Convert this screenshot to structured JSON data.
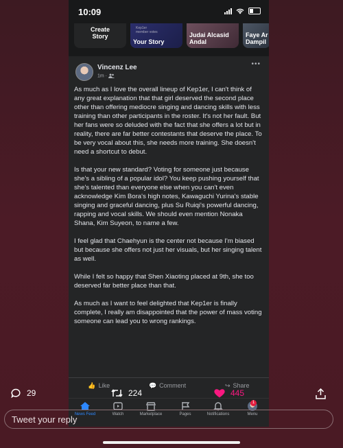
{
  "status": {
    "time": "10:09"
  },
  "stories": [
    {
      "name": "Create\nStory"
    },
    {
      "name": "Your Story",
      "tiny": "Kep1er\nmember votes"
    },
    {
      "name": "Judai Alcasid\nAndal"
    },
    {
      "name": "Faye Ar\nDampil"
    }
  ],
  "post": {
    "author": "Vincenz Lee",
    "time": "1m ·",
    "more": "•••",
    "paragraphs": [
      "As much as I love the overall lineup of Kep1er, I can't think of any great explanation that that girl deserved the second place other than offering mediocre singing and dancing skills with less training than other participants in the roster. It's not her fault. But her fans were so deluded with the fact that she offers a lot but in reality, there are far better contestants that deserve the place. To be very vocal about this, she needs more training. She doesn't need a shortcut to debut.",
      "Is that your new standard? Voting for someone just because she's a sibling of a popular idol? You keep pushing yourself that she's talented than everyone else when you can't even acknowledge Kim Bora's high notes, Kawaguchi Yurina's stable singing and graceful dancing, plus Su Ruiqi's powerful dancing, rapping and vocal skills. We should even mention Nonaka Shana, Kim Suyeon, to name a few.",
      "I feel glad that Chaehyun is the center not because I'm biased but because she offers not just her visuals, but her singing talent as well.",
      "While I felt so happy that Shen Xiaoting placed at 9th, she too deserved far better place than that.",
      "As much as I want to feel delighted that Kep1er is finally complete, I really am disappointed that the power of mass voting someone can lead you to wrong rankings."
    ],
    "actions": {
      "like": "Like",
      "comment": "Comment",
      "share": "Share"
    }
  },
  "tabbar": [
    {
      "label": "News Feed",
      "icon": "home-icon"
    },
    {
      "label": "Watch",
      "icon": "watch-icon"
    },
    {
      "label": "Marketplace",
      "icon": "marketplace-icon"
    },
    {
      "label": "Pages",
      "icon": "flag-icon"
    },
    {
      "label": "Notifications",
      "icon": "bell-icon"
    },
    {
      "label": "Menu",
      "icon": "avatar-icon",
      "badge": "1"
    }
  ],
  "tweet": {
    "replies": "29",
    "retweets": "224",
    "likes": "445",
    "reply_placeholder": "Tweet your reply"
  },
  "colors": {
    "like": "#f91880",
    "fb_blue": "#2d88ff",
    "background": "#4a1b24"
  }
}
